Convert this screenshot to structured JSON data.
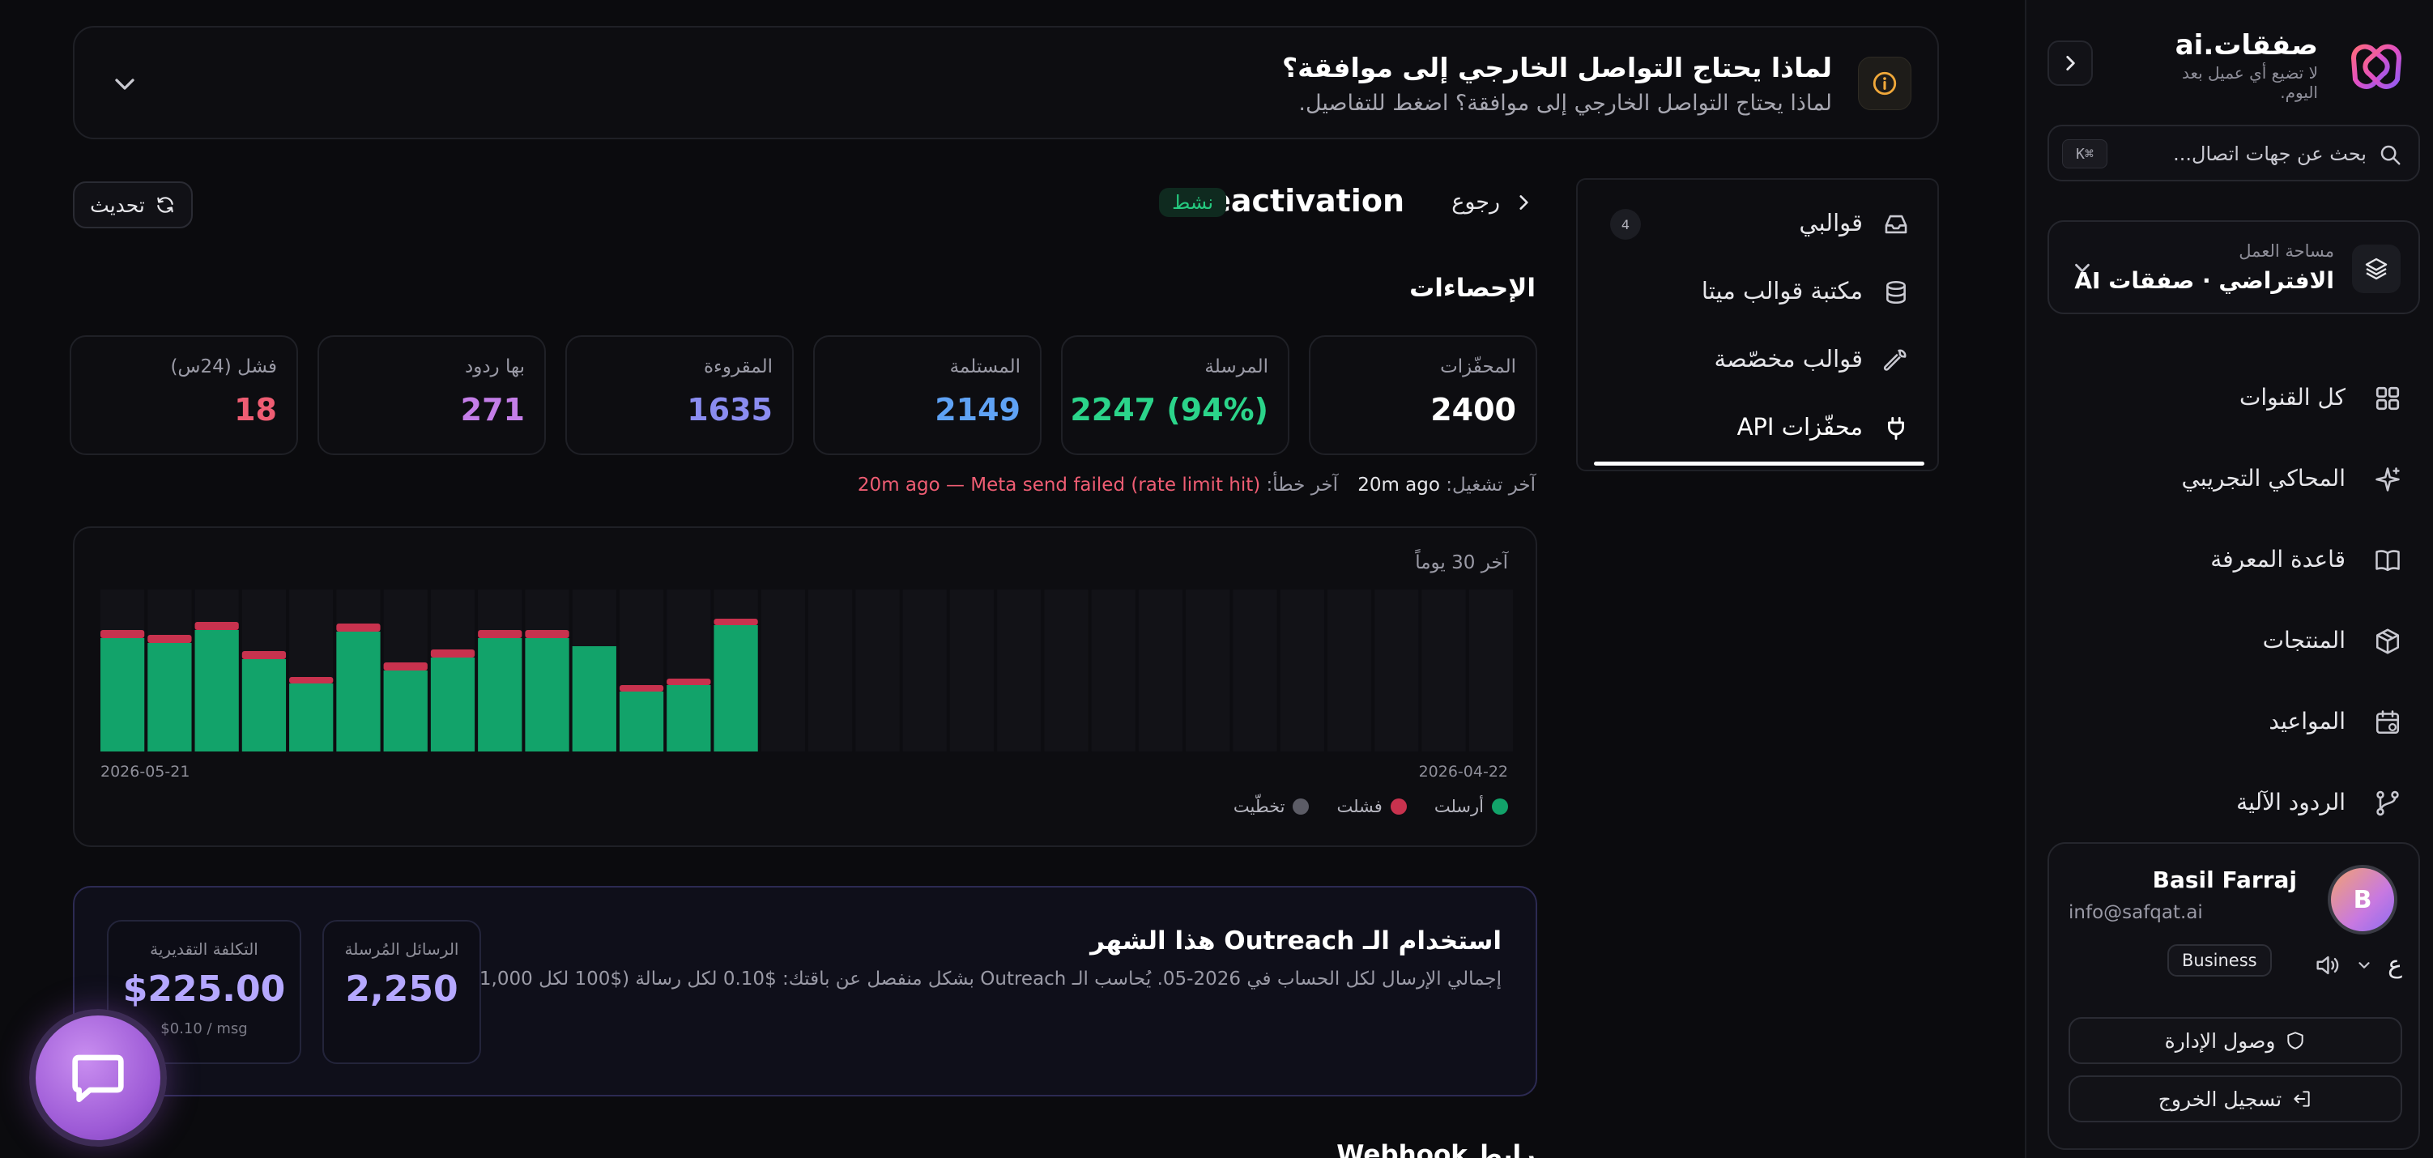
{
  "brand": {
    "name": "صفقات.ai",
    "tagline": "لا تضيع أي عميل بعد اليوم."
  },
  "sidebar": {
    "search": {
      "placeholder": "بحث عن جهات اتصال...",
      "shortcut": "⌘K"
    },
    "workspace": {
      "label": "مساحة العمل",
      "name": "الافتراضي · صفقات AI"
    },
    "nav": [
      {
        "label": "كل القنوات",
        "icon": "grid-icon"
      },
      {
        "label": "المحاكي التجريبي",
        "icon": "sparkles-icon"
      },
      {
        "label": "قاعدة المعرفة",
        "icon": "book-icon"
      },
      {
        "label": "المنتجات",
        "icon": "package-icon"
      },
      {
        "label": "المواعيد",
        "icon": "calendar-icon"
      },
      {
        "label": "الردود الآلية",
        "icon": "git-branch-icon"
      }
    ],
    "user": {
      "initial": "B",
      "name": "Basil Farraj",
      "email": "info@safqat.ai",
      "plan": "Business",
      "lang_toggle": "ع",
      "admin_label": "وصول الإدارة",
      "logout_label": "تسجيل الخروج"
    }
  },
  "banner": {
    "title": "لماذا يحتاج التواصل الخارجي إلى موافقة؟",
    "subtitle": "لماذا يحتاج التواصل الخارجي إلى موافقة؟ اضغط للتفاصيل."
  },
  "templates_menu": {
    "items": [
      {
        "label": "قوالبي",
        "count": "4",
        "icon": "inbox-icon"
      },
      {
        "label": "مكتبة قوالب ميتا",
        "icon": "database-icon"
      },
      {
        "label": "قوالب مخصّصة",
        "icon": "wrench-icon"
      },
      {
        "label": "محفّزات API",
        "icon": "plug-icon"
      }
    ],
    "active_index": 3
  },
  "campaign": {
    "back_label": "رجوع",
    "name": "reactivation",
    "status": "نشط",
    "refresh_label": "تحديث",
    "stats_title": "الإحصاءات",
    "last_run_label": "آخر تشغيل:",
    "last_run_value": "20m ago",
    "last_error_label": "آخر خطأ:",
    "last_error_value": "20m ago — Meta send failed (rate limit hit)"
  },
  "stats": [
    {
      "label": "المحفّزات",
      "value": "2400",
      "color": "#ffffff"
    },
    {
      "label": "المرسلة",
      "value": "2247 (94%)",
      "color": "#2bd48a"
    },
    {
      "label": "المستلمة",
      "value": "2149",
      "color": "#5fa2f5"
    },
    {
      "label": "المقروءة",
      "value": "1635",
      "color": "#8a8cf0"
    },
    {
      "label": "بها ردود",
      "value": "271",
      "color": "#c47ee8"
    },
    {
      "label": "فشل (24س)",
      "value": "18",
      "color": "#ef5d73"
    }
  ],
  "chart_data": {
    "type": "bar",
    "title": "آخر 30 يوماً",
    "x_start": "2026-04-22",
    "x_end": "2026-05-21",
    "direction": "right-to-left",
    "stacked": true,
    "series": [
      {
        "name": "أرسلت",
        "color": "#12a36a",
        "values": [
          0,
          0,
          0,
          0,
          0,
          0,
          0,
          0,
          0,
          0,
          0,
          0,
          0,
          0,
          0,
          0,
          78,
          41,
          37,
          65,
          70,
          70,
          58,
          50,
          74,
          42,
          57,
          75,
          67,
          70
        ]
      },
      {
        "name": "فشلت",
        "color": "#c8324e",
        "values": [
          0,
          0,
          0,
          0,
          0,
          0,
          0,
          0,
          0,
          0,
          0,
          0,
          0,
          0,
          0,
          0,
          4,
          4,
          4,
          0,
          5,
          5,
          5,
          5,
          5,
          4,
          5,
          5,
          5,
          5
        ]
      },
      {
        "name": "تخطّيت",
        "color": "#5c5c66",
        "values": [
          0,
          0,
          0,
          0,
          0,
          0,
          0,
          0,
          0,
          0,
          0,
          0,
          0,
          0,
          0,
          0,
          0,
          0,
          0,
          0,
          0,
          0,
          0,
          0,
          0,
          0,
          0,
          0,
          0,
          0
        ]
      }
    ],
    "ylim": [
      0,
      100
    ]
  },
  "usage": {
    "title": "استخدام الـ Outreach هذا الشهر",
    "description": "إجمالي الإرسال لكل الحساب في 2026-05. يُحاسب الـ Outreach بشكل منفصل عن باقتك: $0.10 لكل رسالة ($100 لكل 1,000).",
    "sent_label": "الرسائل المُرسلة",
    "sent_value": "2,250",
    "cost_label": "التكلفة التقديرية",
    "cost_value": "$225.00",
    "cost_sub": "$0.10 / msg"
  },
  "webhook": {
    "title": "رابط Webhook"
  }
}
